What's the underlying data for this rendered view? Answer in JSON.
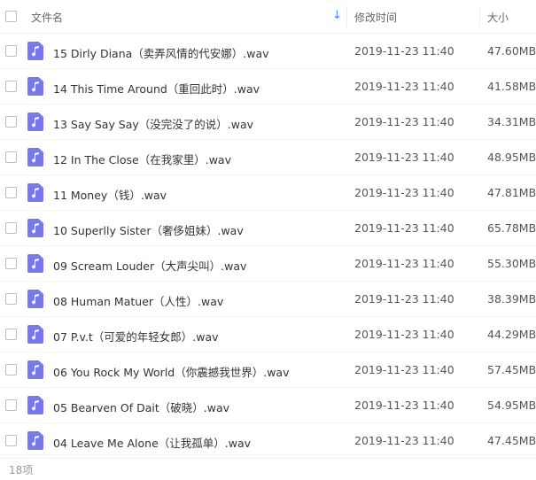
{
  "header": {
    "name_label": "文件名",
    "time_label": "修改时间",
    "size_label": "大小",
    "sort_arrow": "↓"
  },
  "files": [
    {
      "name": "15 Dirly Diana（卖弄风情的代安娜）.wav",
      "time": "2019-11-23 11:40",
      "size": "47.60MB"
    },
    {
      "name": "14 This Time Around（重回此时）.wav",
      "time": "2019-11-23 11:40",
      "size": "41.58MB"
    },
    {
      "name": "13 Say Say Say（没完没了的说）.wav",
      "time": "2019-11-23 11:40",
      "size": "34.31MB"
    },
    {
      "name": "12 In The Close（在我家里）.wav",
      "time": "2019-11-23 11:40",
      "size": "48.95MB"
    },
    {
      "name": "11 Money（钱）.wav",
      "time": "2019-11-23 11:40",
      "size": "47.81MB"
    },
    {
      "name": "10 Superlly Sister（奢侈姐妹）.wav",
      "time": "2019-11-23 11:40",
      "size": "65.78MB"
    },
    {
      "name": "09 Scream Louder（大声尖叫）.wav",
      "time": "2019-11-23 11:40",
      "size": "55.30MB"
    },
    {
      "name": "08 Human Matuer（人性）.wav",
      "time": "2019-11-23 11:40",
      "size": "38.39MB"
    },
    {
      "name": "07 P.v.t（可爱的年轻女郎）.wav",
      "time": "2019-11-23 11:40",
      "size": "44.29MB"
    },
    {
      "name": "06 You Rock My World（你震撼我世界）.wav",
      "time": "2019-11-23 11:40",
      "size": "57.45MB"
    },
    {
      "name": "05 Bearven Of Dait（破晓）.wav",
      "time": "2019-11-23 11:40",
      "size": "54.95MB"
    },
    {
      "name": "04 Leave Me Alone（让我孤单）.wav",
      "time": "2019-11-23 11:40",
      "size": "47.45MB"
    }
  ],
  "footer": {
    "count": "18项"
  },
  "colors": {
    "file_icon": "#7877ee",
    "sort_arrow": "#3b8cff"
  },
  "icons": {
    "file": "music-file-icon",
    "sort": "sort-descending-icon"
  }
}
